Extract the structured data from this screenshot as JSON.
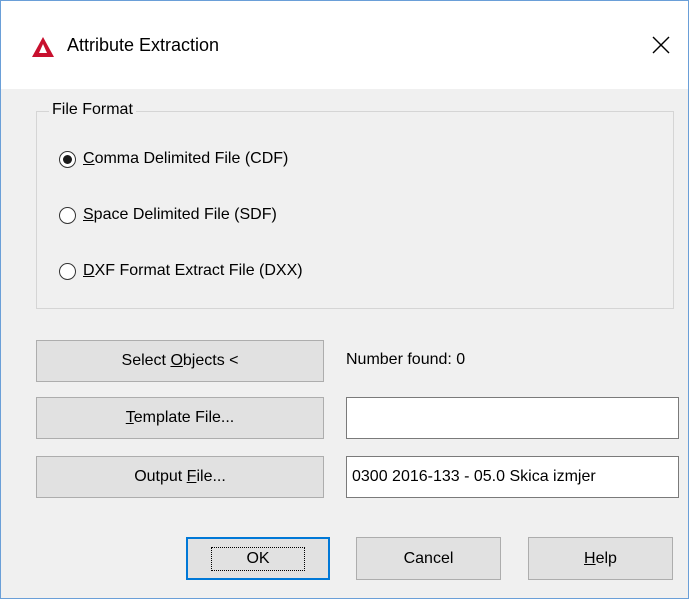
{
  "window": {
    "title": "Attribute Extraction",
    "close_glyph": "✕"
  },
  "file_format": {
    "label": "File Format",
    "options": [
      {
        "mnemonic": "C",
        "rest": "omma Delimited File (CDF)",
        "selected": true
      },
      {
        "mnemonic": "S",
        "rest": "pace Delimited File (SDF)",
        "selected": false
      },
      {
        "mnemonic": "D",
        "rest": "XF Format Extract File (DXX)",
        "selected": false
      }
    ]
  },
  "select_objects": {
    "pre": "Select ",
    "mnemonic": "O",
    "post": "bjects <",
    "number_found": "Number found:  0"
  },
  "template_file": {
    "mnemonic": "T",
    "post": "emplate File...",
    "value": ""
  },
  "output_file": {
    "pre": "Output ",
    "mnemonic": "F",
    "post": "ile...",
    "value": "0300 2016-133 - 05.0 Skica izmjer"
  },
  "footer": {
    "ok": "OK",
    "cancel": "Cancel",
    "help_mnemonic": "H",
    "help_post": "elp"
  },
  "colors": {
    "autocad_red": "#c8102e",
    "default_button_border": "#0078d7"
  }
}
